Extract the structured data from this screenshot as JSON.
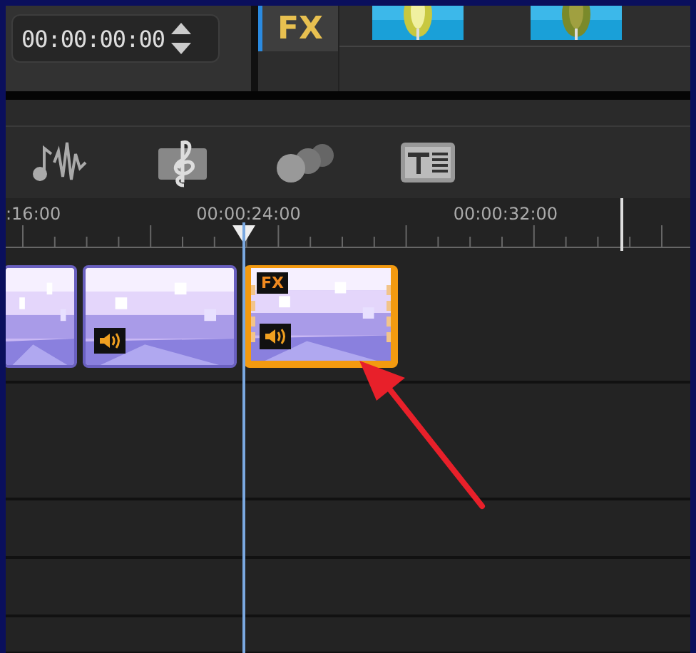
{
  "timecode": {
    "value": "00:00:00:00"
  },
  "library_tabs": [
    {
      "label": "FX",
      "selected": true
    }
  ],
  "ruler": {
    "labels": [
      ":16:00",
      "00:00:24:00",
      "00:00:32:00"
    ]
  },
  "clips": [
    {
      "selected": false,
      "audio": false
    },
    {
      "selected": false,
      "audio": true
    },
    {
      "selected": true,
      "audio": true,
      "badge": "FX"
    }
  ]
}
